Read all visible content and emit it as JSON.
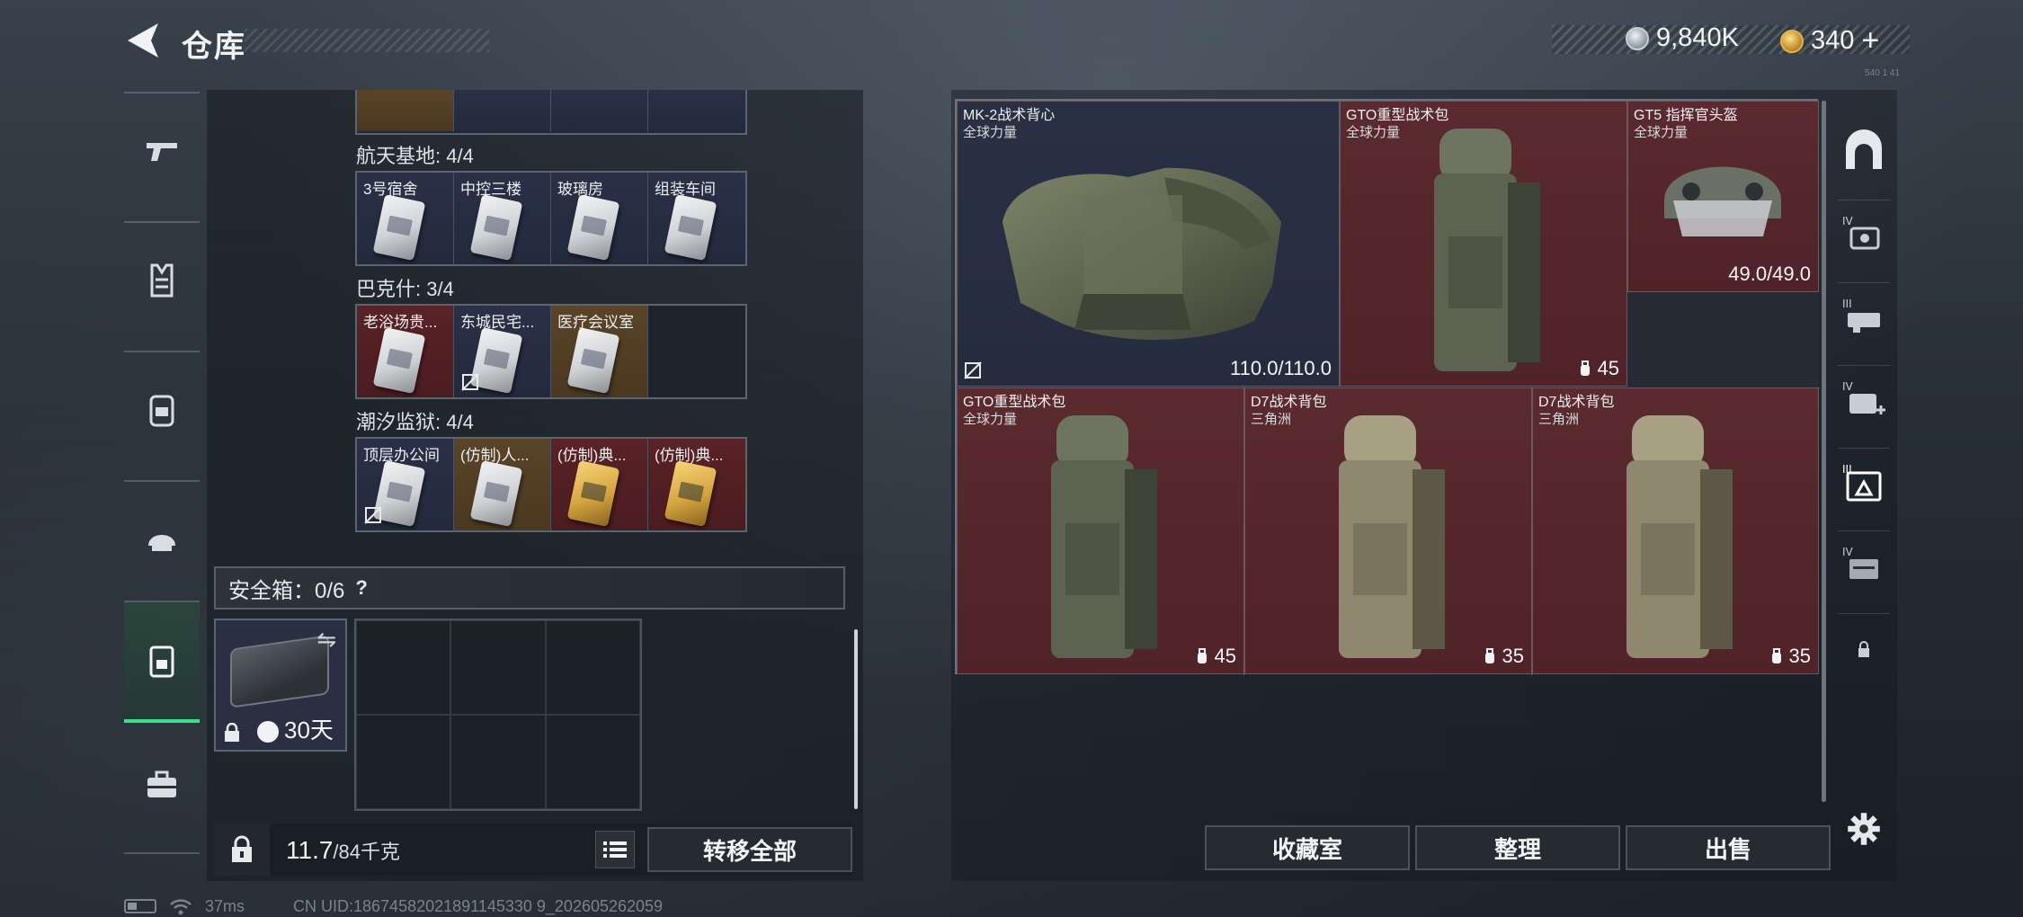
{
  "header": {
    "title": "仓库",
    "currency_silver": "9,840K",
    "currency_gold": "340",
    "currency_gold_plus": "+",
    "version": "540 1 41"
  },
  "colors": {
    "accent_green": "#3ce08a",
    "slot_red": "#5a2a2e",
    "slot_blue": "#2a3044",
    "slot_gold": "#5a4428"
  },
  "left_nav": {
    "items": [
      {
        "icon": "pistol-icon"
      },
      {
        "icon": "armor-icon"
      },
      {
        "icon": "backpack-icon"
      },
      {
        "icon": "helmet-icon"
      },
      {
        "icon": "secure-case-icon",
        "active": true
      },
      {
        "icon": "briefcase-icon"
      }
    ]
  },
  "key_regions": [
    {
      "label": "航天基地: 4/4",
      "keys": [
        {
          "name": "3号宿舍",
          "color": "blue",
          "card": "white"
        },
        {
          "name": "中控三楼",
          "color": "blue",
          "card": "white"
        },
        {
          "name": "玻璃房",
          "color": "blue",
          "card": "white"
        },
        {
          "name": "组装车间",
          "color": "blue",
          "card": "white"
        }
      ]
    },
    {
      "label": "巴克什: 3/4",
      "keys": [
        {
          "name": "老浴场贵...",
          "color": "red",
          "card": "white"
        },
        {
          "name": "东城民宅...",
          "color": "blue",
          "card": "white",
          "no_drop": true
        },
        {
          "name": "医疗会议室",
          "color": "gold",
          "card": "white"
        },
        {
          "name": "",
          "color": "empty"
        }
      ]
    },
    {
      "label": "潮汐监狱: 4/4",
      "keys": [
        {
          "name": "顶层办公间",
          "color": "blue",
          "card": "white",
          "no_drop": true
        },
        {
          "name": "(仿制)人...",
          "color": "gold",
          "card": "white"
        },
        {
          "name": "(仿制)典...",
          "color": "red",
          "card": "gold"
        },
        {
          "name": "(仿制)典...",
          "color": "red",
          "card": "gold"
        }
      ]
    }
  ],
  "safebox": {
    "label": "安全箱：0/6",
    "help": "?",
    "swap_icon": "⇋",
    "days": "30天"
  },
  "bottom_left": {
    "weight_current": "11.7",
    "weight_max": "/84千克",
    "transfer_all": "转移全部"
  },
  "stash_items": [
    {
      "name": "MK-2战术背心",
      "sub": "全球力量",
      "value": "110.0/110.0",
      "no_drop": true,
      "color": "blue"
    },
    {
      "name": "GTO重型战术包",
      "sub": "全球力量",
      "value": "45",
      "color": "red"
    },
    {
      "name": "GT5 指挥官头盔",
      "sub": "全球力量",
      "value": "49.0/49.0",
      "color": "red"
    },
    {
      "name": "GTO重型战术包",
      "sub": "全球力量",
      "value": "45",
      "color": "red"
    },
    {
      "name": "D7战术背包",
      "sub": "三角洲",
      "value": "35",
      "color": "red"
    },
    {
      "name": "D7战术背包",
      "sub": "三角洲",
      "value": "35",
      "color": "red"
    }
  ],
  "right_buttons": {
    "collection": "收藏室",
    "sort": "整理",
    "sell": "出售"
  },
  "right_nav": {
    "items": [
      {
        "icon": "arch-icon"
      },
      {
        "icon": "iv-case-icon",
        "tier": "IV"
      },
      {
        "icon": "iii-gun-case-icon",
        "tier": "III"
      },
      {
        "icon": "iv-medkit-icon",
        "tier": "IV"
      },
      {
        "icon": "iii-tool-case-icon",
        "tier": "III",
        "active": true
      },
      {
        "icon": "iv-ammo-case-icon",
        "tier": "IV"
      },
      {
        "icon": "lock-icon"
      },
      {
        "icon": "gear-icon"
      }
    ],
    "tiers": [
      "IV",
      "III",
      "IV",
      "III",
      "IV"
    ]
  },
  "status_bar": {
    "ping": "37ms",
    "uid": "CN UID:18674582021891145330 9_202605262059"
  }
}
